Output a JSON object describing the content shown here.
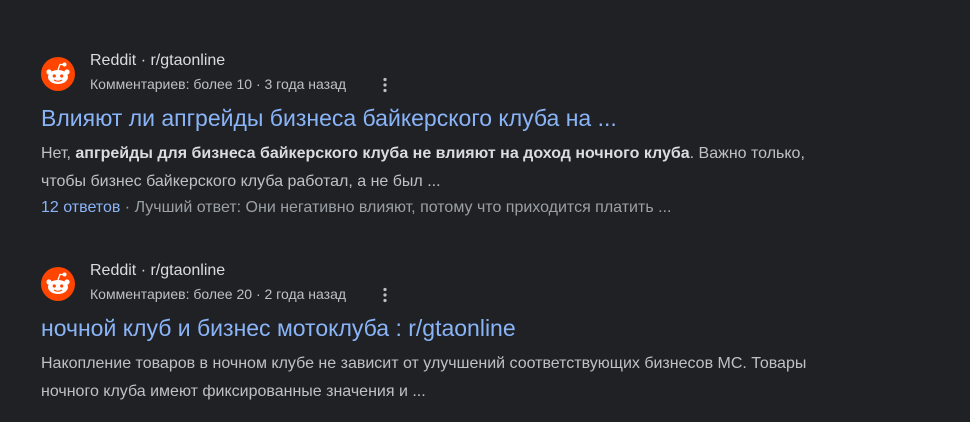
{
  "results": [
    {
      "favicon": "reddit-icon",
      "site": "Reddit · r/gtaonline",
      "meta": "Комментариев: более 10 · 3 года назад",
      "title": "Влияют ли апгрейды бизнеса байкерского клуба на ...",
      "snippet_start": "Нет, ",
      "snippet_bold": "апгрейды для бизнеса байкерского клуба не влияют на доход ночного клуба",
      "snippet_end": ". Важно только, чтобы бизнес байкерского клуба работал, а не был ...",
      "answers_link": "12 ответов",
      "answers_rest": " · Лучший ответ: Они негативно влияют, потому что приходится платить ..."
    },
    {
      "favicon": "reddit-icon",
      "site": "Reddit · r/gtaonline",
      "meta": "Комментариев: более 20 · 2 года назад",
      "title": "ночной клуб и бизнес мотоклуба : r/gtaonline",
      "snippet_start": "Накопление товаров в ночном клубе не зависит от улучшений соответствующих бизнесов МС. Товары ночного клуба имеют фиксированные значения и ..."
    }
  ],
  "colors": {
    "background": "#202124",
    "link": "#8ab4f8",
    "text": "#bdc1c6",
    "reddit_orange": "#ff4500"
  }
}
